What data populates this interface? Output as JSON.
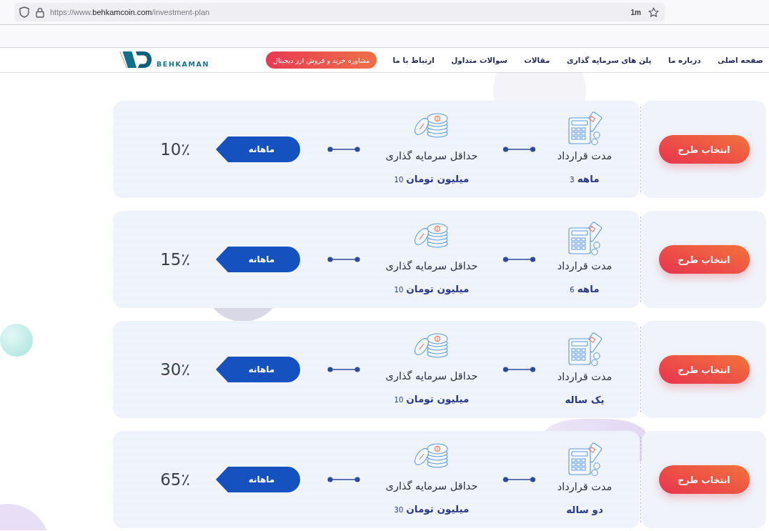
{
  "browser": {
    "url": {
      "prefix": "https://www.",
      "domain": "behkamcoin.com",
      "path": "/investment-plan"
    },
    "indicator": "1m"
  },
  "header": {
    "logo": {
      "text": "BEHKAMAN"
    },
    "cta_button": "مشاوره خرید و فروش ارز دیجیتال",
    "nav": [
      "صفحه اصلی",
      "درباره ما",
      "پلن های سرمایه گذاری",
      "مقالات",
      "سوالات متداول",
      "ارتباط با ما"
    ]
  },
  "plans": [
    {
      "rate": "10٪",
      "period": "ماهانه",
      "min_investment": {
        "label": "حداقل سرمایه گذاری",
        "amount": "10",
        "unit": "میلیون تومان"
      },
      "duration": {
        "label": "مدت قرارداد",
        "number": "3",
        "unit": "ماهه"
      },
      "button": "انتخاب طرح"
    },
    {
      "rate": "15٪",
      "period": "ماهانه",
      "min_investment": {
        "label": "حداقل سرمایه گذاری",
        "amount": "10",
        "unit": "میلیون تومان"
      },
      "duration": {
        "label": "مدت قرارداد",
        "number": "6",
        "unit": "ماهه"
      },
      "button": "انتخاب طرح"
    },
    {
      "rate": "30٪",
      "period": "ماهانه",
      "min_investment": {
        "label": "حداقل سرمایه گذاری",
        "amount": "10",
        "unit": "میلیون تومان"
      },
      "duration": {
        "label": "مدت قرارداد",
        "unit": "یک ساله"
      },
      "button": "انتخاب طرح"
    },
    {
      "rate": "65٪",
      "period": "ماهانه",
      "min_investment": {
        "label": "حداقل سرمایه گذاری",
        "amount": "30",
        "unit": "میلیون تومان"
      },
      "duration": {
        "label": "مدت قرارداد",
        "unit": "دو ساله"
      },
      "button": "انتخاب طرح"
    }
  ]
}
